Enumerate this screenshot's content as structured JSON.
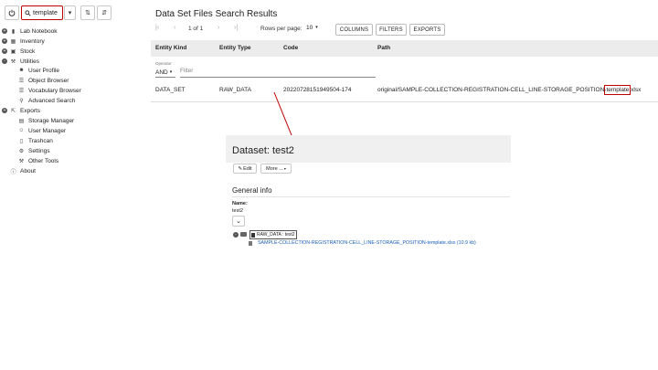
{
  "toolbar": {
    "search_value": "template"
  },
  "sidebar": {
    "items": [
      {
        "label": "Lab Notebook",
        "toggle": "+",
        "icon": "book-icon"
      },
      {
        "label": "Inventory",
        "toggle": "+",
        "icon": "cubes-icon"
      },
      {
        "label": "Stock",
        "toggle": "+",
        "icon": "cart-icon"
      },
      {
        "label": "Utilities",
        "toggle": "-",
        "icon": "wrench-icon"
      },
      {
        "label": "User Profile",
        "icon": "user-icon"
      },
      {
        "label": "Object Browser",
        "icon": "list-icon"
      },
      {
        "label": "Vocabulary Browser",
        "icon": "list-icon"
      },
      {
        "label": "Advanced Search",
        "icon": "search-icon"
      },
      {
        "label": "Exports",
        "toggle": "+",
        "icon": "export-icon"
      },
      {
        "label": "Storage Manager",
        "icon": "storage-icon"
      },
      {
        "label": "User Manager",
        "icon": "users-icon"
      },
      {
        "label": "Trashcan",
        "icon": "trash-icon"
      },
      {
        "label": "Settings",
        "icon": "gear-icon"
      },
      {
        "label": "Other Tools",
        "icon": "wrench-icon"
      },
      {
        "label": "About",
        "icon": "info-icon"
      }
    ]
  },
  "results": {
    "title": "Data Set Files Search Results",
    "page_info": "1 of 1",
    "rows_per_page_label": "Rows per page:",
    "rows_per_page_value": "10",
    "buttons": {
      "columns": "COLUMNS",
      "filters": "FILTERS",
      "exports": "EXPORTS"
    },
    "columns": [
      "Entity Kind",
      "Entity Type",
      "Code",
      "Path"
    ],
    "operator_label": "Operator",
    "operator_value": "AND",
    "filter_placeholder": "Filter",
    "rows": [
      {
        "entity_kind": "DATA_SET",
        "entity_type": "RAW_DATA",
        "code": "20220728151949504-174",
        "path_prefix": "original/SAMPLE-COLLECTION-REGISTRATION-CELL_LINE-STORAGE_POSITION-",
        "path_highlight": "template",
        "path_suffix": ".xlsx"
      }
    ]
  },
  "dataset": {
    "title": "Dataset: test2",
    "edit_label": "Edit",
    "more_label": "More ...",
    "general_info_title": "General info",
    "name_label": "Name:",
    "name_value": "test2",
    "tree_root": "RAW_DATA : test2",
    "file_link": "SAMPLE-COLLECTION-REGISTRATION-CELL_LINE-STORAGE_POSITION-template.xlsx (10.9 kb)"
  },
  "colors": {
    "highlight_red": "#c00000",
    "link_blue": "#1a5fb4",
    "header_gray": "#ececec"
  }
}
